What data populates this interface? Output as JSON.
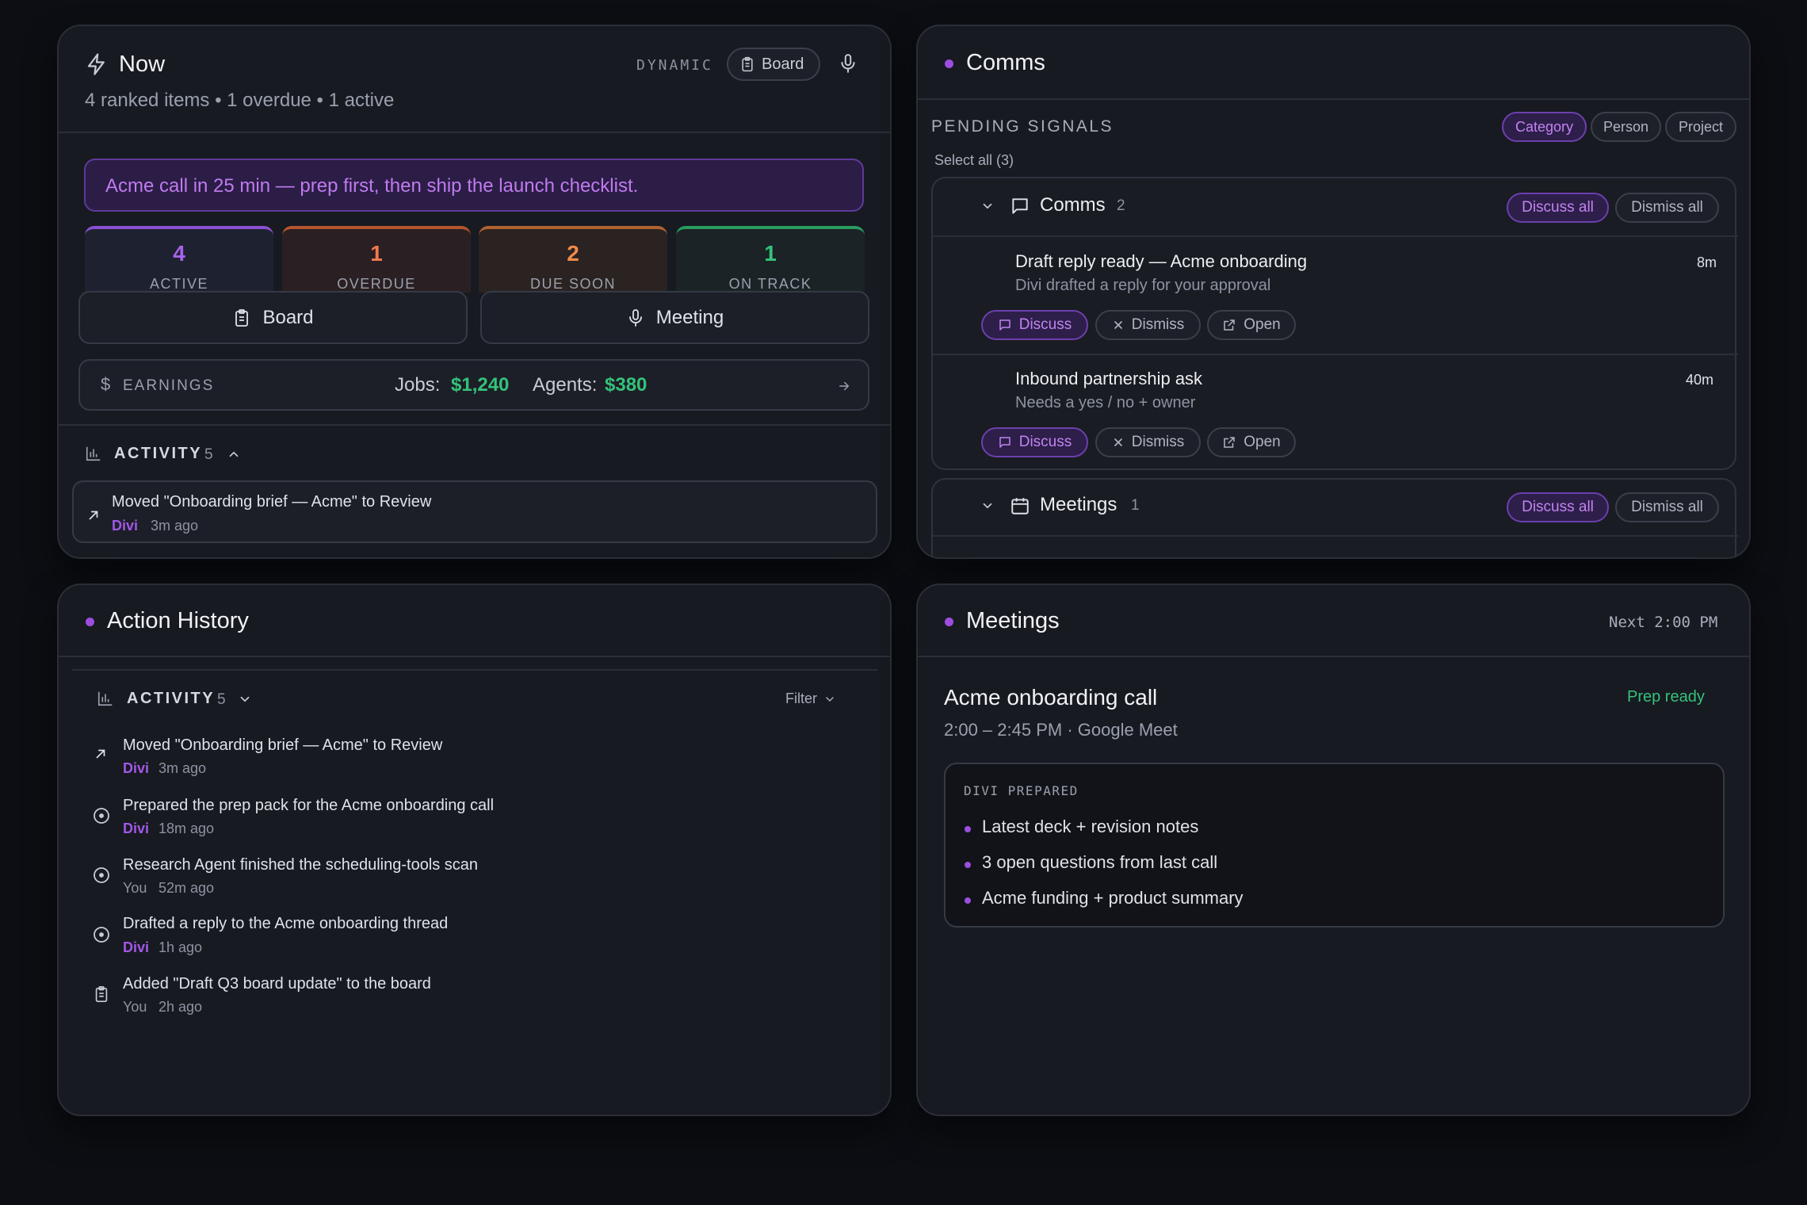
{
  "now": {
    "title": "Now",
    "subtitle": "4 ranked items • 1 overdue • 1 active",
    "mode": "DYNAMIC",
    "board_label": "Board",
    "banner": "Acme call in 25 min — prep first, then ship the launch checklist.",
    "stats": [
      {
        "value": "4",
        "label": "ACTIVE",
        "color": "#a862ec"
      },
      {
        "value": "1",
        "label": "OVERDUE",
        "color": "#f0794f"
      },
      {
        "value": "2",
        "label": "DUE SOON",
        "color": "#f08a4b"
      },
      {
        "value": "1",
        "label": "ON TRACK",
        "color": "#34c27a"
      }
    ],
    "board_button": "Board",
    "meeting_button": "Meeting",
    "earnings": {
      "label": "EARNINGS",
      "jobs_label": "Jobs:",
      "jobs_value": "$1,240",
      "agents_label": "Agents:",
      "agents_value": "$380"
    },
    "activity": {
      "label": "ACTIVITY",
      "count": "5",
      "item": {
        "text": "Moved \"Onboarding brief — Acme\" to Review",
        "who": "Divi",
        "ago": "3m ago"
      }
    }
  },
  "comms": {
    "title": "Comms",
    "section_label": "PENDING SIGNALS",
    "filters": [
      "Category",
      "Person",
      "Project"
    ],
    "select_all": "Select all (3)",
    "groups": [
      {
        "name": "Comms",
        "count": "2",
        "discuss_all": "Discuss all",
        "dismiss_all": "Dismiss all",
        "items": [
          {
            "title": "Draft reply ready — Acme onboarding",
            "sub": "Divi drafted a reply for your approval",
            "time": "8m"
          },
          {
            "title": "Inbound partnership ask",
            "sub": "Needs a yes / no + owner",
            "time": "40m"
          }
        ]
      },
      {
        "name": "Meetings",
        "count": "1",
        "discuss_all": "Discuss all",
        "dismiss_all": "Dismiss all"
      }
    ],
    "actions": {
      "discuss": "Discuss",
      "dismiss": "Dismiss",
      "open": "Open"
    }
  },
  "history": {
    "title": "Action History",
    "activity_label": "ACTIVITY",
    "count": "5",
    "filter": "Filter",
    "items": [
      {
        "text": "Moved \"Onboarding brief — Acme\" to Review",
        "who": "Divi",
        "ago": "3m ago",
        "icon": "arrow-up-right-icon"
      },
      {
        "text": "Prepared the prep pack for the Acme onboarding call",
        "who": "Divi",
        "ago": "18m ago",
        "icon": "circle-dot-icon"
      },
      {
        "text": "Research Agent finished the scheduling-tools scan",
        "who": "You",
        "ago": "52m ago",
        "icon": "circle-dot-icon"
      },
      {
        "text": "Drafted a reply to the Acme onboarding thread",
        "who": "Divi",
        "ago": "1h ago",
        "icon": "circle-dot-icon"
      },
      {
        "text": "Added \"Draft Q3 board update\" to the board",
        "who": "You",
        "ago": "2h ago",
        "icon": "clipboard-icon"
      }
    ]
  },
  "meetings": {
    "title": "Meetings",
    "next": "Next 2:00 PM",
    "meeting_title": "Acme onboarding call",
    "meeting_time": "2:00 – 2:45 PM · Google Meet",
    "status": "Prep ready",
    "prepared_label": "DIVI PREPARED",
    "bullets": [
      "Latest deck + revision notes",
      "3 open questions from last call",
      "Acme funding + product summary"
    ]
  },
  "colors": {
    "accent": "#9b4ee0",
    "green": "#34c27a",
    "orange": "#f0794f"
  }
}
